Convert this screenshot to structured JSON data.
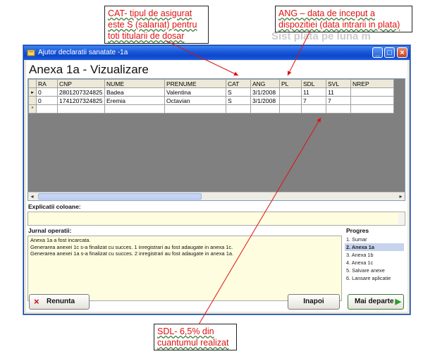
{
  "callouts": {
    "cat": {
      "lines": [
        "CAT- tipul de asigurat",
        "este S (salariat) pentru",
        "toti titularii de dosar"
      ]
    },
    "ang": {
      "lines": [
        "ANG – data de inceput  a",
        "dispozitiei (data intrarii in plata)"
      ]
    },
    "sdl": {
      "lines": [
        "SDL- 6,5% din",
        "cuantumul realizat"
      ]
    }
  },
  "bg_text": "Sist plata pe luna m",
  "window": {
    "title": "Ajutor declaratii sanatate -1a",
    "heading": "Anexa 1a - Vizualizare"
  },
  "grid": {
    "columns": [
      "RA",
      "CNP",
      "NUME",
      "PRENUME",
      "CAT",
      "ANG",
      "PL",
      "SDL",
      "SVL",
      "NREP"
    ],
    "rows": [
      {
        "marker": "▸",
        "RA": "0",
        "CNP": "2801207324825",
        "NUME": "Badea",
        "PRENUME": "Valentina",
        "CAT": "S",
        "ANG": "3/1/2008",
        "PL": "",
        "SDL": "11",
        "SVL": "11",
        "NREP": ""
      },
      {
        "marker": "",
        "RA": "0",
        "CNP": "1741207324825",
        "NUME": "Eremia",
        "PRENUME": "Octavian",
        "CAT": "S",
        "ANG": "3/1/2008",
        "PL": "",
        "SDL": "7",
        "SVL": "7",
        "NREP": ""
      },
      {
        "marker": "*",
        "RA": "",
        "CNP": "",
        "NUME": "",
        "PRENUME": "",
        "CAT": "",
        "ANG": "",
        "PL": "",
        "SDL": "",
        "SVL": "",
        "NREP": ""
      }
    ]
  },
  "explicatii_label": "Explicatii coloane:",
  "jurnal_label": "Jurnal operatii:",
  "jurnal_lines": [
    "Anexa 1a a fost incarcata.",
    "Generarea anexei 1c s-a finalizat cu succes. 1 inregistrari au fost adaugate in anexa 1c.",
    "Generarea anexei 1a s-a finalizat cu succes. 2 inregistrari au fost adaugate in anexa 1a."
  ],
  "progres": {
    "label": "Progres",
    "steps": [
      "1. Sumar",
      "2. Anexa 1a",
      "3. Anexa 1b",
      "4. Anexa 1c",
      "5. Salvare anexe",
      "6. Lansare aplicatie"
    ],
    "selected_index": 1
  },
  "buttons": {
    "renunta": "Renunta",
    "inapoi": "Inapoi",
    "mai_departe": "Mai departe"
  },
  "colors": {
    "callout_text": "#e01010",
    "arrow": "#e01010",
    "titlebar": "#1856d8",
    "selected_step": "#c5d3ec"
  }
}
